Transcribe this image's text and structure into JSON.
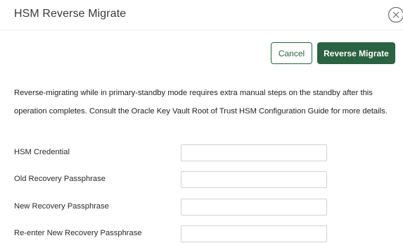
{
  "dialog": {
    "title": "HSM Reverse Migrate",
    "close_icon": "close-circle-icon"
  },
  "actions": {
    "cancel_label": "Cancel",
    "primary_label": "Reverse Migrate",
    "primary_color": "#2b6242"
  },
  "message": {
    "text": "Reverse-migrating while in primary-standby mode requires extra manual steps on the standby after this operation completes. Consult the Oracle Key Vault Root of Trust HSM Configuration Guide for more details."
  },
  "form": {
    "fields": [
      {
        "label": "HSM Credential",
        "value": ""
      },
      {
        "label": "Old Recovery Passphrase",
        "value": ""
      },
      {
        "label": "New Recovery Passphrase",
        "value": ""
      },
      {
        "label": "Re-enter New Recovery Passphrase",
        "value": ""
      }
    ]
  }
}
